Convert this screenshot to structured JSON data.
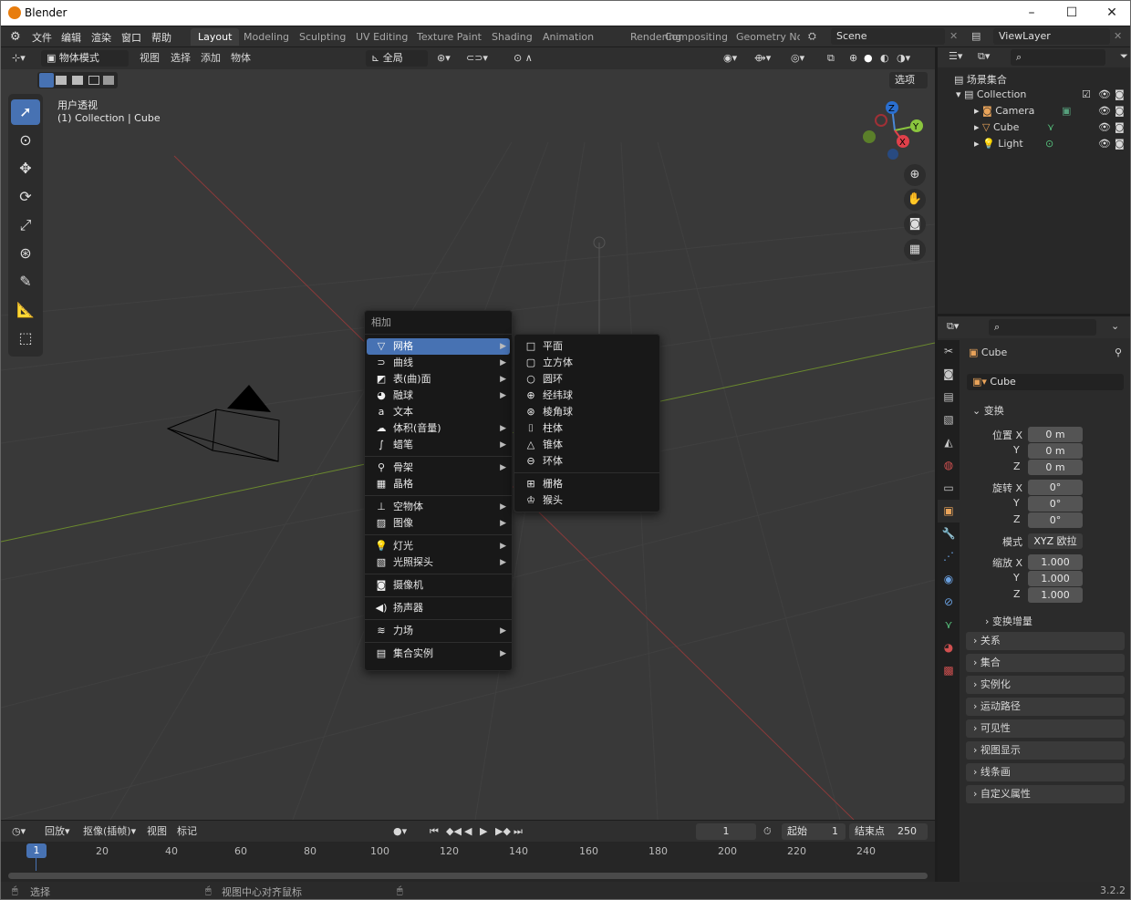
{
  "app": {
    "title": "Blender",
    "version": "3.2.2"
  },
  "window_controls": {
    "minimize": "–",
    "maximize": "☐",
    "close": "✕"
  },
  "menubar": {
    "items": [
      "文件",
      "编辑",
      "渲染",
      "窗口",
      "帮助"
    ]
  },
  "workspaces": [
    "Layout",
    "Modeling",
    "Sculpting",
    "UV Editing",
    "Texture Paint",
    "Shading",
    "Animation",
    "Rendering",
    "Compositing",
    "Geometry Noc"
  ],
  "scene": {
    "name": "Scene"
  },
  "view_layer": {
    "name": "ViewLayer"
  },
  "viewport_header": {
    "mode": "物体模式",
    "menus": [
      "视图",
      "选择",
      "添加",
      "物体"
    ],
    "orientation": "全局",
    "options": "选项"
  },
  "viewport_overlay": {
    "view_name": "用户透视",
    "context": "(1) Collection | Cube"
  },
  "add_menu": {
    "title": "相加",
    "items": [
      {
        "icon": "▽",
        "label": "网格",
        "submenu": true,
        "highlight": true
      },
      {
        "icon": "⊃",
        "label": "曲线",
        "submenu": true
      },
      {
        "icon": "◩",
        "label": "表(曲)面",
        "submenu": true
      },
      {
        "icon": "◕",
        "label": "融球",
        "submenu": true
      },
      {
        "icon": "a",
        "label": "文本",
        "submenu": false
      },
      {
        "icon": "☁",
        "label": "体积(音量)",
        "submenu": true
      },
      {
        "icon": "∫",
        "label": "蜡笔",
        "submenu": true
      },
      {
        "icon": "⚲",
        "label": "骨架",
        "submenu": true
      },
      {
        "icon": "▦",
        "label": "晶格",
        "submenu": false
      },
      {
        "icon": "⊥",
        "label": "空物体",
        "submenu": true
      },
      {
        "icon": "▨",
        "label": "图像",
        "submenu": true
      },
      {
        "icon": "💡",
        "label": "灯光",
        "submenu": true
      },
      {
        "icon": "▧",
        "label": "光照探头",
        "submenu": true
      },
      {
        "icon": "◙",
        "label": "摄像机",
        "submenu": false
      },
      {
        "icon": "◀)",
        "label": "扬声器",
        "submenu": false
      },
      {
        "icon": "≋",
        "label": "力场",
        "submenu": true
      },
      {
        "icon": "▤",
        "label": "集合实例",
        "submenu": true
      }
    ]
  },
  "mesh_submenu": {
    "items": [
      {
        "icon": "□",
        "label": "平面"
      },
      {
        "icon": "▢",
        "label": "立方体"
      },
      {
        "icon": "○",
        "label": "圆环"
      },
      {
        "icon": "⊕",
        "label": "经纬球"
      },
      {
        "icon": "⊛",
        "label": "棱角球"
      },
      {
        "icon": "⌷",
        "label": "柱体"
      },
      {
        "icon": "△",
        "label": "锥体"
      },
      {
        "icon": "⊖",
        "label": "环体"
      },
      {
        "icon": "⊞",
        "label": "栅格"
      },
      {
        "icon": "♔",
        "label": "猴头"
      }
    ]
  },
  "outliner": {
    "root": "场景集合",
    "collection": "Collection",
    "objects": [
      "Camera",
      "Cube",
      "Light"
    ]
  },
  "properties": {
    "object_name": "Cube",
    "data_name": "Cube",
    "transform_header": "变换",
    "location_label": "位置 X",
    "rotation_label": "旋转 X",
    "scale_label": "缩放 X",
    "axis_y": "Y",
    "axis_z": "Z",
    "location": [
      "0 m",
      "0 m",
      "0 m"
    ],
    "rotation": [
      "0°",
      "0°",
      "0°"
    ],
    "mode_label": "模式",
    "mode_value": "XYZ 欧拉",
    "scale": [
      "1.000",
      "1.000",
      "1.000"
    ],
    "delta": "变换增量",
    "panels": [
      "关系",
      "集合",
      "实例化",
      "运动路径",
      "可见性",
      "视图显示",
      "线条画",
      "自定义属性"
    ]
  },
  "timeline": {
    "menus": [
      "回放",
      "抠像(插帧)",
      "视图",
      "标记"
    ],
    "current_frame": "1",
    "start_label": "起始",
    "start": "1",
    "end_label": "结束点",
    "end": "250",
    "ticks": [
      "1",
      "20",
      "40",
      "60",
      "80",
      "100",
      "120",
      "140",
      "160",
      "180",
      "200",
      "220",
      "240"
    ]
  },
  "status": {
    "select": "选择",
    "center": "视图中心对齐鼠标"
  }
}
